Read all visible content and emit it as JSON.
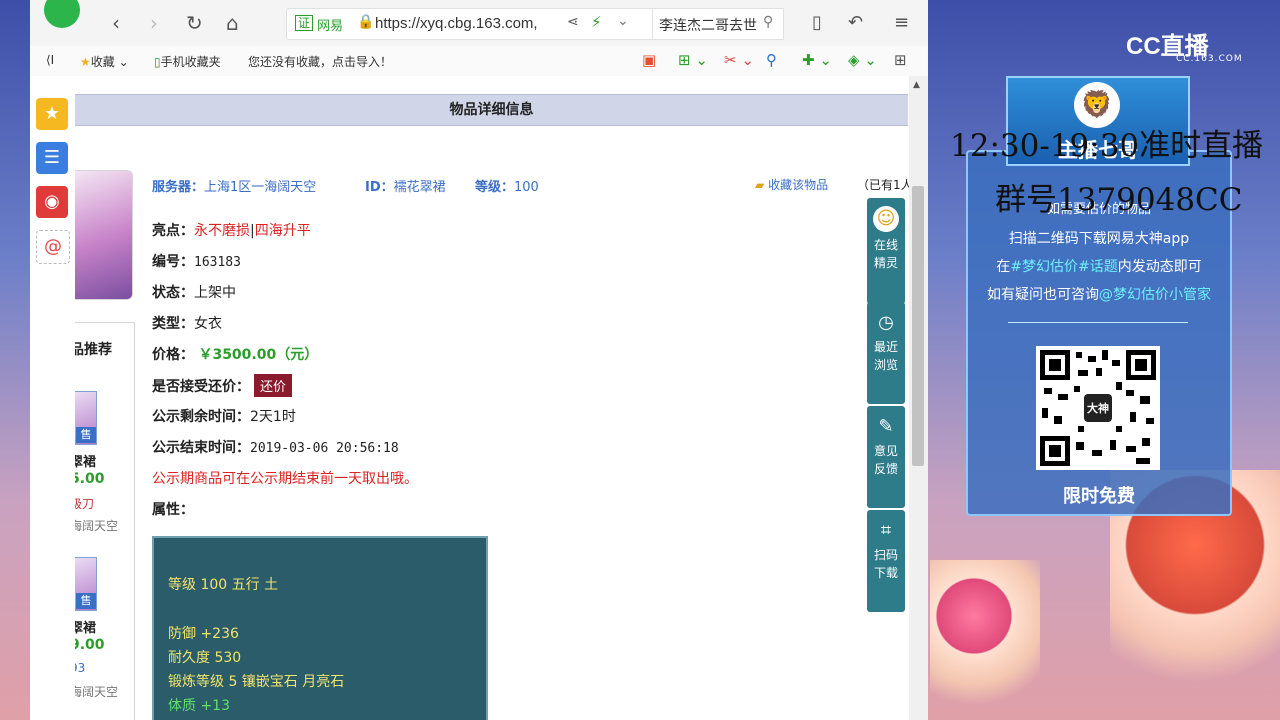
{
  "browser": {
    "address": {
      "cert_badge": "证",
      "site_label": "网易",
      "url": "https://xyq.cbg.163.com,"
    },
    "search": {
      "text": "李连杰二哥去世"
    },
    "bookmarks": {
      "collapse": "⟨I",
      "favorites": "收藏",
      "mobile_favorites": "手机收藏夹",
      "empty_hint": "您还没有收藏，点击导入！"
    }
  },
  "page": {
    "title": "物品详细信息",
    "header": {
      "server_label": "服务器：",
      "server_value": "上海1区一海阔天空",
      "id_label": "ID：",
      "id_value": "襦花翠裙",
      "level_label": "等级：",
      "level_value": "100"
    },
    "favorite_label": "收藏该物品",
    "favorite_count": "（已有1人",
    "details": {
      "highlight_label": "亮点：",
      "highlight_1": "永不磨损",
      "highlight_sep": "|",
      "highlight_2": "四海升平",
      "number_label": "编号：",
      "number_value": "163183",
      "status_label": "状态：",
      "status_value": "上架中",
      "type_label": "类型：",
      "type_value": "女衣",
      "price_label": "价格：",
      "price_value": "￥3500.00（元）",
      "bargain_label": "是否接受还价：",
      "bargain_button": "还价",
      "remaining_label": "公示剩余时间：",
      "remaining_value": "2天1时",
      "end_label": "公示结束时间：",
      "end_value": "2019-03-06 20:56:18",
      "notice": "公示期商品可在公示期结束前一天取出哦。",
      "attributes_label": "属性："
    },
    "attributes": {
      "line1": "等级 100 五行 土",
      "line2": "防御 +236",
      "line3": "耐久度 530",
      "line4": "锻炼等级 5 镶嵌宝石 月亮石",
      "line5": "体质 +13"
    },
    "recommend": {
      "title": "品推荐",
      "items": [
        {
          "badge": "售",
          "name": "翠裙",
          "price": "5.00",
          "extra": "级刀",
          "server": "海阔天空"
        },
        {
          "badge": "售",
          "name": "翠裙",
          "price": "9.00",
          "extra": "93",
          "server": "海阔天空"
        }
      ]
    },
    "float_panel": {
      "online": "在线\n精灵",
      "recent": "最近\n浏览",
      "feedback": "意见\n反馈",
      "scan": "扫码\n下载"
    }
  },
  "stream": {
    "logo": "CC直播",
    "logo_sub": "CC.163.COM",
    "host_name": "主播七哥",
    "schedule": "12:30-19:30准时直播",
    "group": "群号1379048CC",
    "qr_lines": {
      "l1": "如需要估价的物品",
      "l2": "扫描二维码下载网易大神app",
      "l3a": "在",
      "l3b": "#梦幻估价#话题",
      "l3c": "内发动态即可",
      "l4a": "如有疑问也可咨询",
      "l4b": "@梦幻估价小管家"
    },
    "qr_center": "大神",
    "free": "限时免费"
  },
  "colors": {
    "accent_blue": "#3a6ec6",
    "price_green": "#2a9d2a",
    "attr_bg": "#2b5c6a",
    "bargain": "#8b1a2c"
  }
}
